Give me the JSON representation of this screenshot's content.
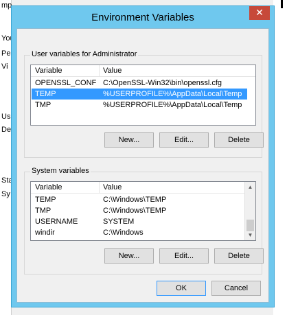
{
  "background": {
    "fragments": [
      "mp",
      "You",
      "Pe",
      "Vi",
      "Us",
      "De",
      "Sta",
      "Sy"
    ]
  },
  "dialog": {
    "title": "Environment Variables",
    "close_label": "✕"
  },
  "user_vars": {
    "label": "User variables for Administrator",
    "columns": [
      "Variable",
      "Value"
    ],
    "rows": [
      {
        "variable": "OPENSSL_CONF",
        "value": "C:\\OpenSSL-Win32\\bin\\openssl.cfg",
        "selected": false
      },
      {
        "variable": "TEMP",
        "value": "%USERPROFILE%\\AppData\\Local\\Temp",
        "selected": true
      },
      {
        "variable": "TMP",
        "value": "%USERPROFILE%\\AppData\\Local\\Temp",
        "selected": false
      }
    ],
    "buttons": {
      "new": "New...",
      "edit": "Edit...",
      "delete": "Delete"
    }
  },
  "system_vars": {
    "label": "System variables",
    "columns": [
      "Variable",
      "Value"
    ],
    "rows": [
      {
        "variable": "TEMP",
        "value": "C:\\Windows\\TEMP"
      },
      {
        "variable": "TMP",
        "value": "C:\\Windows\\TEMP"
      },
      {
        "variable": "USERNAME",
        "value": "SYSTEM"
      },
      {
        "variable": "windir",
        "value": "C:\\Windows"
      }
    ],
    "buttons": {
      "new": "New...",
      "edit": "Edit...",
      "delete": "Delete"
    }
  },
  "footer": {
    "ok": "OK",
    "cancel": "Cancel"
  },
  "icons": {
    "scroll_up": "up-arrow-icon",
    "scroll_down": "down-arrow-icon",
    "close": "close-icon"
  }
}
